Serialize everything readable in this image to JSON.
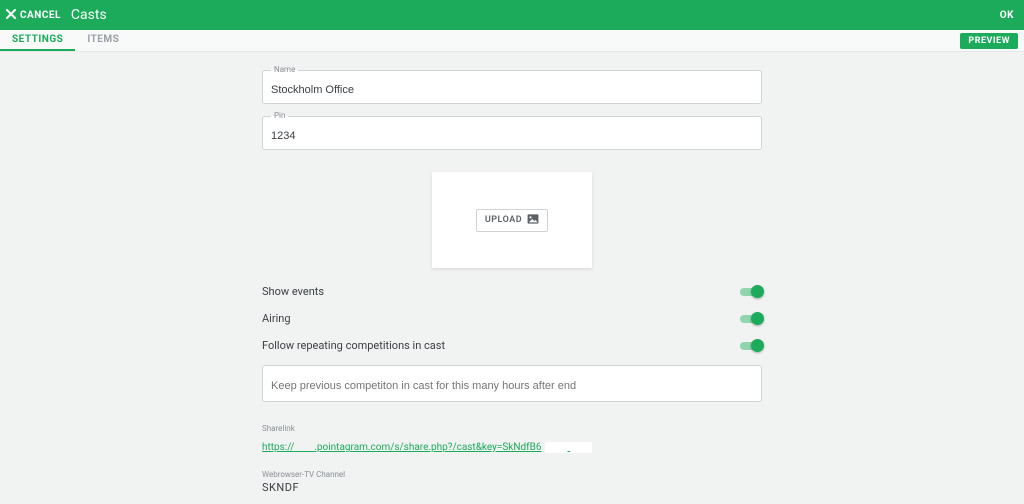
{
  "topbar": {
    "cancel_label": "CANCEL",
    "title": "Casts",
    "ok_label": "OK"
  },
  "tabs": {
    "settings": "SETTINGS",
    "items": "ITEMS",
    "preview": "PREVIEW"
  },
  "fields": {
    "name_label": "Name",
    "name_value": "Stockholm Office",
    "pin_label": "Pin",
    "pin_value": "1234",
    "upload_label": "UPLOAD",
    "keep_placeholder": "Keep previous competiton in cast for this many hours after end"
  },
  "toggles": {
    "show_events": {
      "label": "Show events",
      "on": true
    },
    "airing": {
      "label": "Airing",
      "on": true
    },
    "follow_repeating": {
      "label": "Follow repeating competitions in cast",
      "on": true
    }
  },
  "share": {
    "label": "Sharelink",
    "protocol": "https://",
    "rest": ".pointagram.com/s/share.php?/cast&key=SkNdfB6"
  },
  "channel": {
    "label": "Webrowser-TV Channel",
    "value": "SKNDF"
  }
}
